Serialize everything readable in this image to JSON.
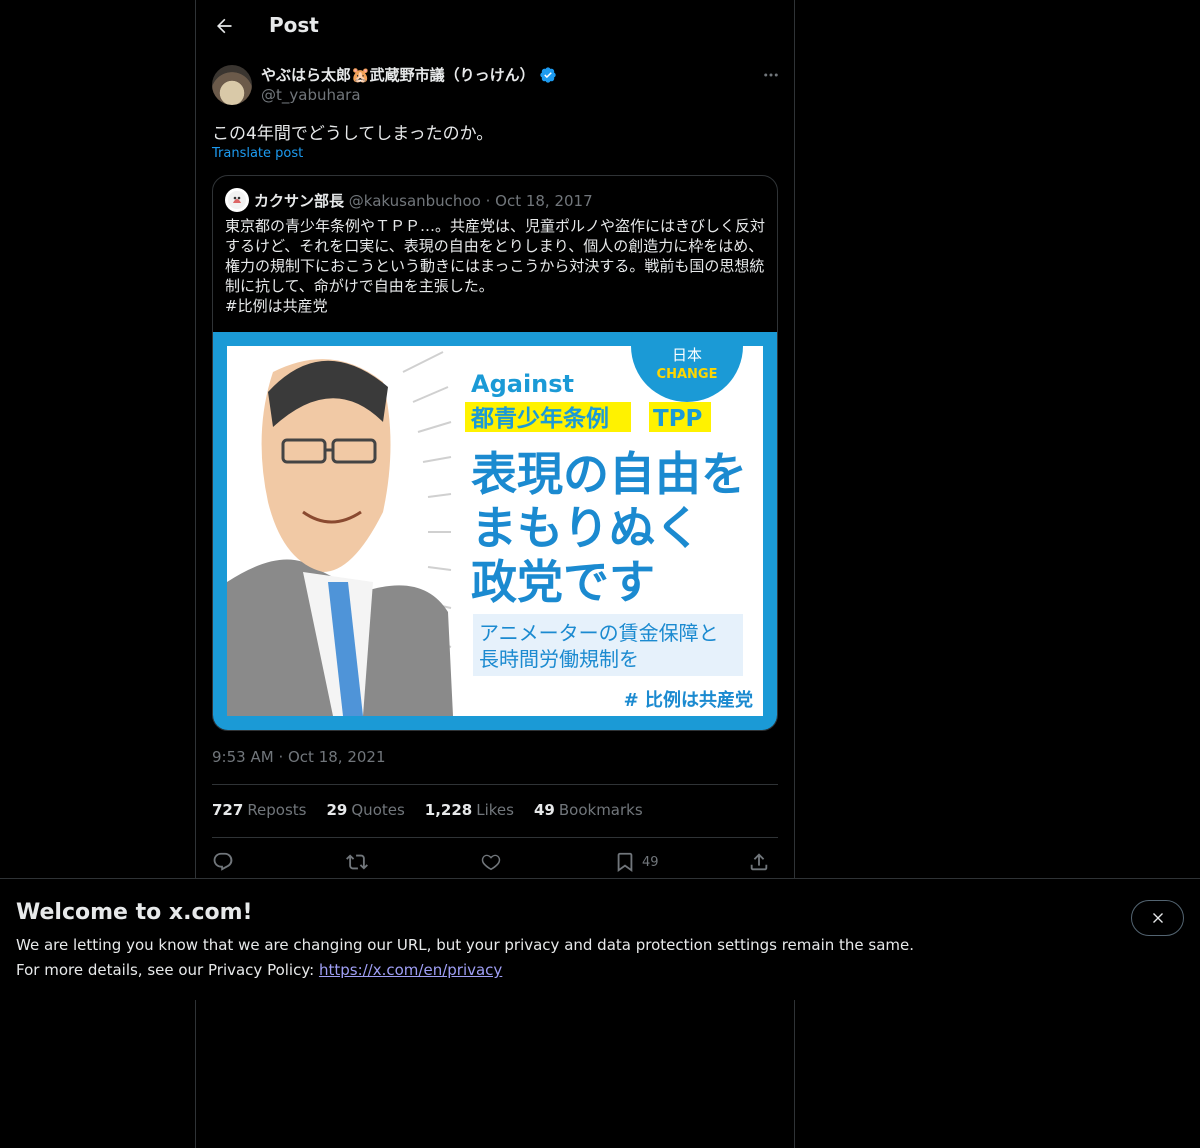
{
  "header": {
    "title": "Post"
  },
  "post": {
    "author_name": "やぶはら太郎🐹武蔵野市議（りっけん）",
    "author_handle": "@t_yabuhara",
    "text": "この4年間でどうしてしまったのか。",
    "translate_label": "Translate post",
    "timestamp_time": "9:53 AM",
    "timestamp_sep": "·",
    "timestamp_date": "Oct 18, 2021"
  },
  "quote": {
    "author_name": "カクサン部長",
    "author_handle": "@kakusanbuchoo",
    "sep": "·",
    "date": "Oct 18, 2017",
    "text": "東京都の青少年条例やＴＰＰ…。共産党は、児童ポルノや盗作にはきびしく反対するけど、それを口実に、表現の自由をとりしまり、個人の創造力に枠をはめ、権力の規制下におこうという動きにはまっこうから対決する。戦前も国の思想統制に抗して、命がけで自由を主張した。\n#比例は共産党",
    "image": {
      "badge_top": "日本",
      "badge_bottom": "CHANGE",
      "against": "Against",
      "tag1": "都青少年条例",
      "tag2": "TPP",
      "headline1": "表現の自由を",
      "headline2": "まもりぬく",
      "headline3": "政党です",
      "sub1": "アニメーターの賃金保障と",
      "sub2": "長時間労働規制を",
      "hashtag": "# 比例は共産党"
    }
  },
  "stats": {
    "reposts_count": "727",
    "reposts_label": "Reposts",
    "quotes_count": "29",
    "quotes_label": "Quotes",
    "likes_count": "1,228",
    "likes_label": "Likes",
    "bookmarks_count": "49",
    "bookmarks_label": "Bookmarks"
  },
  "actions": {
    "bookmark_count": "49",
    "icons": [
      "reply-icon",
      "repost-icon",
      "like-icon",
      "bookmark-icon",
      "share-icon"
    ]
  },
  "banner": {
    "title": "Welcome to x.com!",
    "line1": "We are letting you know that we are changing our URL, but your privacy and data protection settings remain the same.",
    "line2_prefix": "For more details, see our Privacy Policy:",
    "link": "https://x.com/en/privacy"
  },
  "colors": {
    "background": "#000000",
    "accent": "#1d9bf0",
    "muted": "#71767b",
    "border": "#2f3336",
    "link": "#9f9ff5"
  }
}
